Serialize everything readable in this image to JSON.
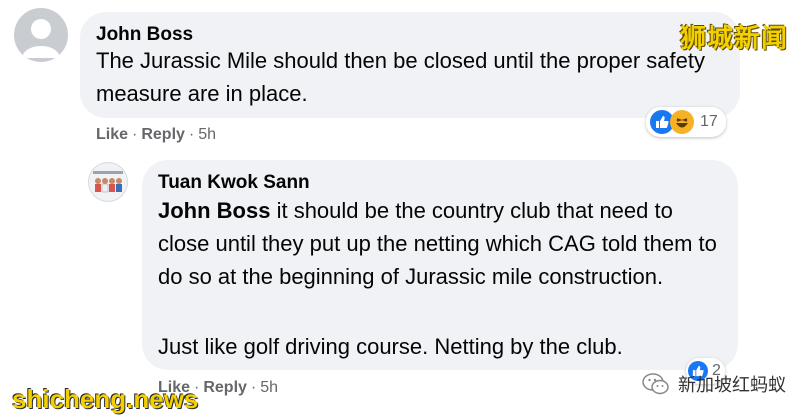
{
  "comments": [
    {
      "author": "John Boss",
      "text": "The Jurassic Mile should then be closed until the proper safety measure are in place.",
      "actions": {
        "like": "Like",
        "reply": "Reply",
        "time": "5h"
      },
      "reaction_count": "17",
      "reactions": [
        "like-icon",
        "haha-icon"
      ]
    },
    {
      "author": "Tuan Kwok Sann",
      "mention": "John Boss",
      "text": " it should be the country club that need to close until they put up the netting which CAG told them to do so at the beginning of Jurassic mile construction.",
      "text2": "Just like golf driving course. Netting by the club.",
      "actions": {
        "like": "Like",
        "reply": "Reply",
        "time": "5h"
      },
      "reaction_count": "2",
      "reactions": [
        "like-icon"
      ]
    }
  ],
  "separator": "·",
  "watermarks": {
    "top": "狮城新闻",
    "bottom": "shicheng.news",
    "wechat": "新加坡红蚂蚁"
  },
  "colors": {
    "bubble": "#f0f2f5",
    "meta_text": "#65676b",
    "like_blue": "#1877f2",
    "watermark_yellow": "#f5d000"
  }
}
